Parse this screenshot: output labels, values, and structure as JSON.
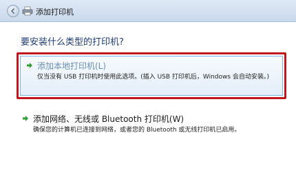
{
  "window": {
    "title": "添加打印机"
  },
  "main": {
    "heading": "要安装什么类型的打印机?",
    "options": [
      {
        "title": "添加本地打印机(L)",
        "description": "仅当没有 USB 打印机时使用此选项。(插入 USB 打印机后，Windows 会自动安装。)",
        "selected": true
      },
      {
        "title": "添加网络、无线或 Bluetooth 打印机(W)",
        "description": "确保您的计算机已连接到网络，或者您的 Bluetooth 或无线打印机已启用。",
        "selected": false
      }
    ]
  },
  "icons": {
    "back": "back-arrow-icon",
    "printer": "printer-icon",
    "option_arrow": "green-arrow-icon"
  },
  "colors": {
    "heading": "#1e3c78",
    "selection_border": "#c0161d",
    "arrow": "#2f9e2f"
  }
}
